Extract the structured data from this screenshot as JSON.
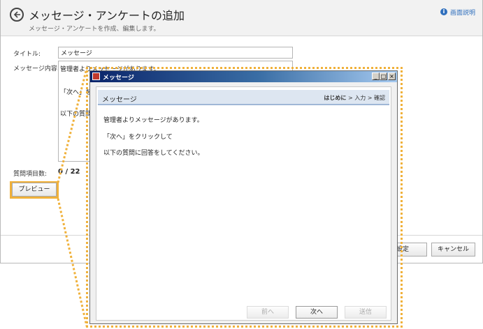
{
  "app": {
    "title": "メッセージ・アンケートの追加",
    "subtitle": "メッセージ・アンケートを作成、編集します。",
    "help_link": "画面説明",
    "help_icon": "info-icon"
  },
  "form": {
    "title_label": "タイトル:",
    "title_value": "メッセージ",
    "message_label": "メッセージ内容:",
    "message_lines": [
      "管理者よりメッセージがあります。",
      "「次へ」をクリ",
      "以下の質問"
    ],
    "question_count_label": "質問項目数:",
    "question_count_value": "0 / 22",
    "preview_button": "プレビュー"
  },
  "footer": {
    "settings_button": "設定",
    "cancel_button": "キャンセル"
  },
  "popup": {
    "window_title": "メッセージ",
    "section_title": "メッセージ",
    "steps": {
      "current": "はじめに",
      "rest": " > 入力 > 確認"
    },
    "body_lines": [
      "管理者よりメッセージがあります。",
      "「次へ」をクリックして",
      "以下の質問に回答をしてください。"
    ],
    "prev_button": "前へ",
    "next_button": "次へ",
    "send_button": "送信"
  },
  "colors": {
    "highlight": "#f0b13a",
    "link": "#2f6fbd",
    "titlebar": "#0a246a"
  }
}
